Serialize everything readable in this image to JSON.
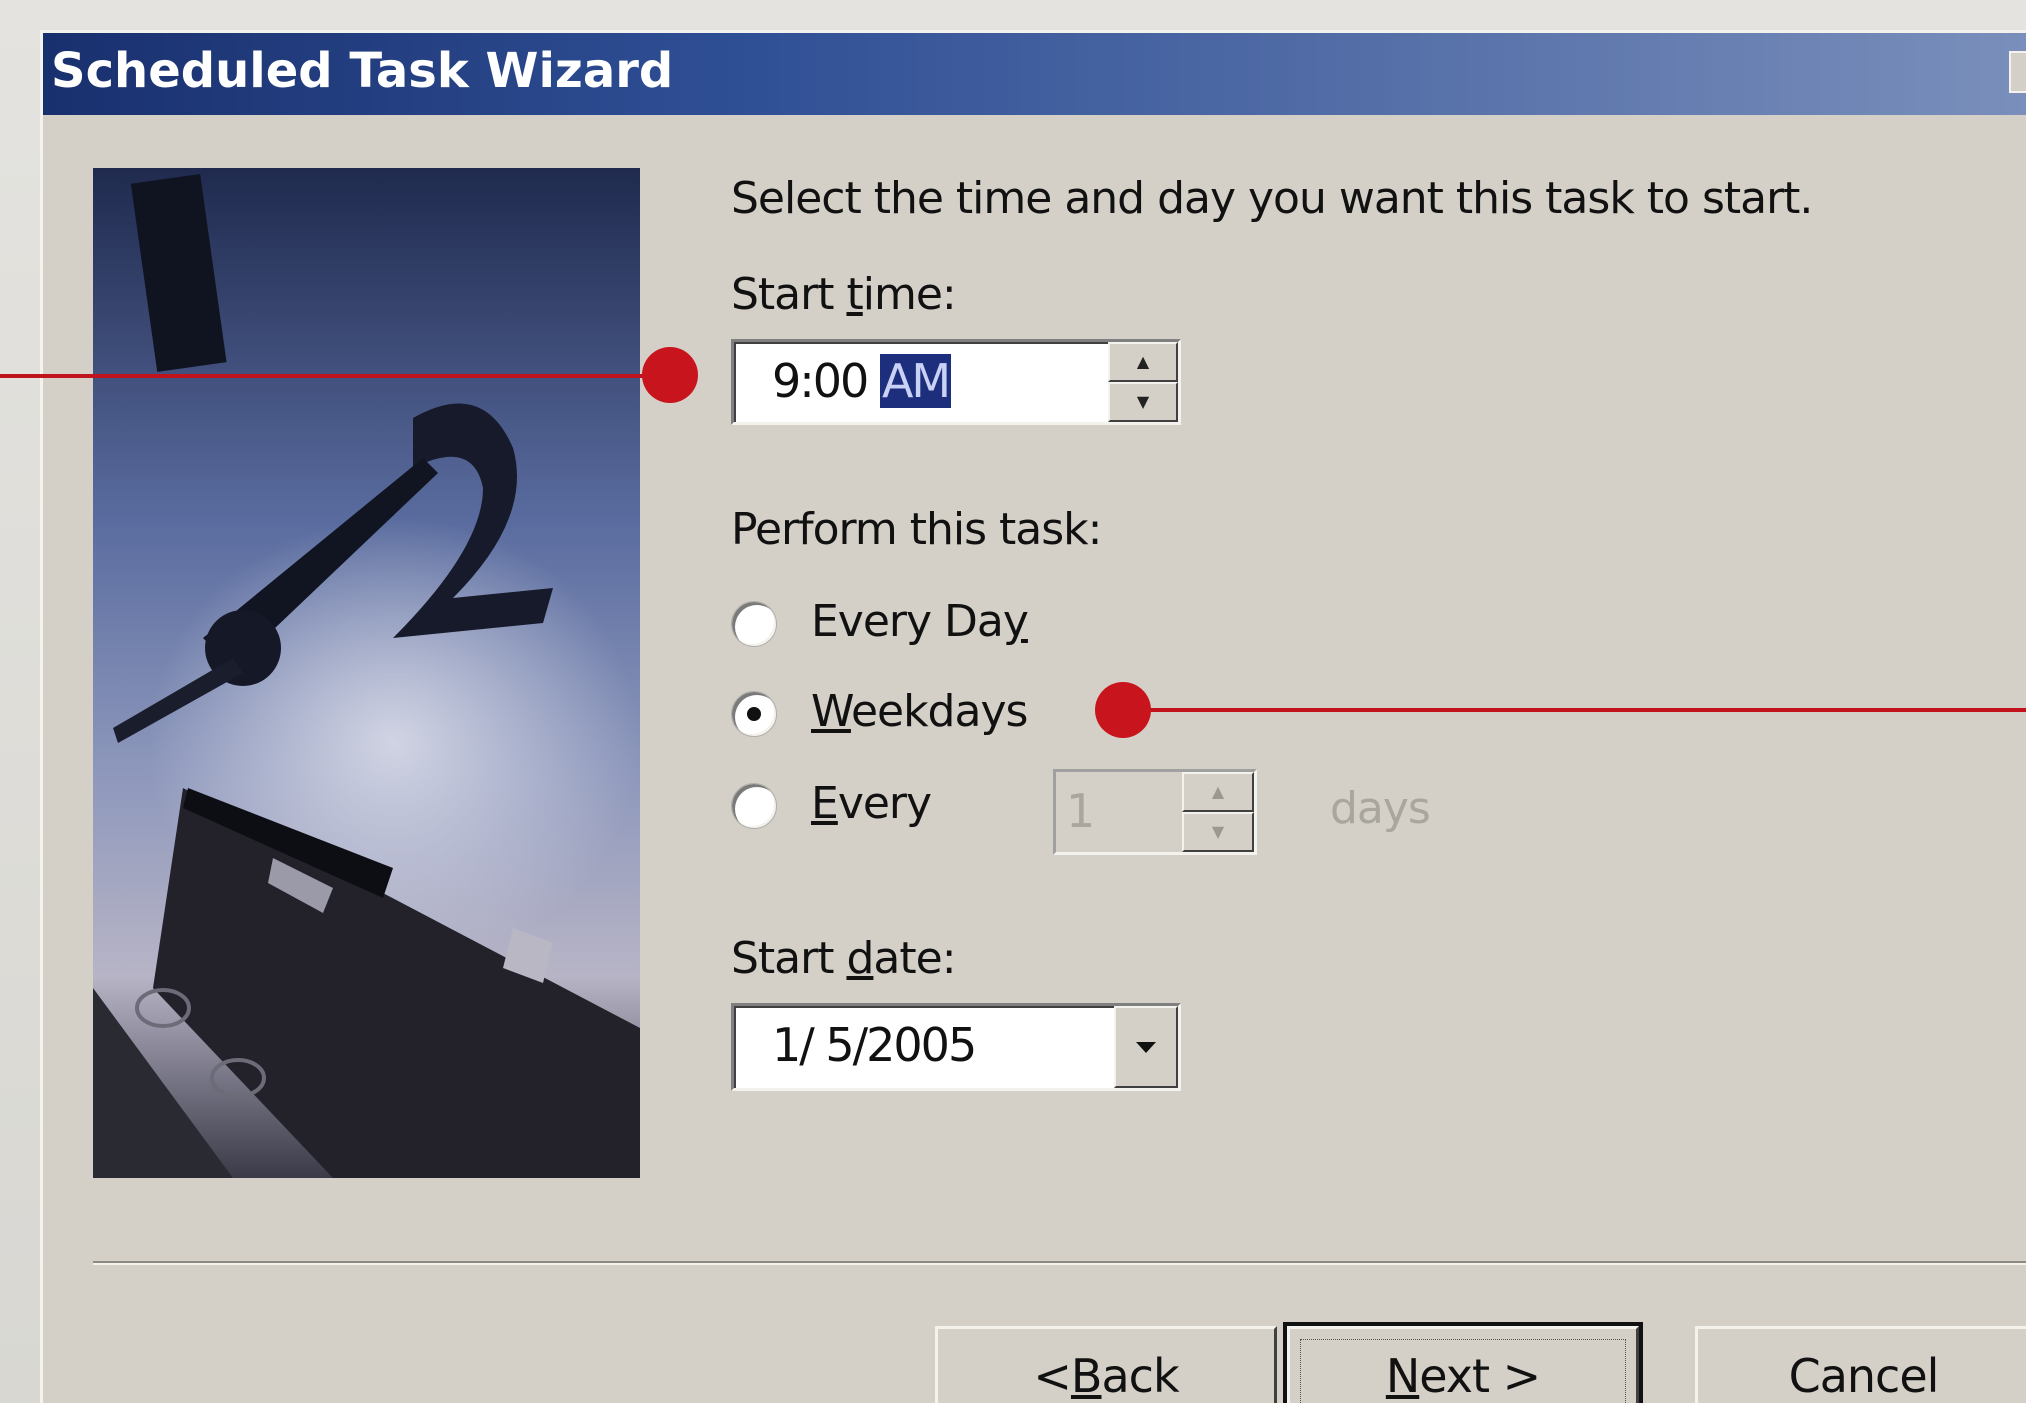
{
  "window": {
    "title": "Scheduled Task Wizard"
  },
  "instruction": "Select the time and day you want this task to start.",
  "start_time": {
    "label_pre": "Start ",
    "label_hotkey": "t",
    "label_post": "ime:",
    "hour_minute": "9:00",
    "ampm": "AM"
  },
  "perform": {
    "label": "Perform this task:",
    "options": [
      {
        "pre": "Every Da",
        "hotkey": "y",
        "post": "",
        "selected": false
      },
      {
        "pre": "",
        "hotkey": "W",
        "post": "eekdays",
        "selected": true
      },
      {
        "pre": "",
        "hotkey": "E",
        "post": "very",
        "selected": false
      }
    ],
    "every_value": "1",
    "every_unit": "days"
  },
  "start_date": {
    "label_pre": "Start ",
    "label_hotkey": "d",
    "label_post": "ate:",
    "value": "1/ 5/2005"
  },
  "buttons": {
    "back_pre": "< ",
    "back_hotkey": "B",
    "back_post": "ack",
    "next_pre": "",
    "next_hotkey": "N",
    "next_post": "ext >",
    "cancel": "Cancel"
  },
  "colors": {
    "callout": "#c8141c",
    "titlebar_start": "#19306e",
    "selection": "#1d2e7c"
  }
}
